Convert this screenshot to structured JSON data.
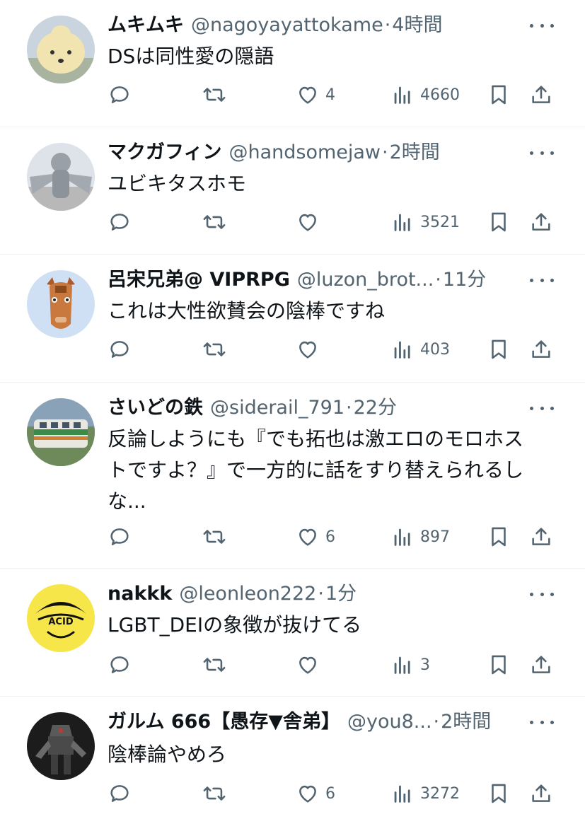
{
  "tweets": [
    {
      "name": "ムキムキ",
      "handle": "@nagoyayattokame",
      "sep": "·",
      "time": "4時間",
      "text": "DSは同性愛の隠語",
      "likes": "4",
      "views": "4660",
      "avatar": "avatar-1"
    },
    {
      "name": "マクガフィン",
      "handle": "@handsomejaw",
      "sep": "·",
      "time": "2時間",
      "text": "ユビキタスホモ",
      "likes": "",
      "views": "3521",
      "avatar": "avatar-2"
    },
    {
      "name": "呂宋兄弟@ VIPRPG",
      "handle": "@luzon_brot...",
      "sep": "·",
      "time": "11分",
      "text": "これは大性欲賛会の陰棒ですね",
      "likes": "",
      "views": "403",
      "avatar": "avatar-3"
    },
    {
      "name": "さいどの鉄",
      "handle": "@siderail_791",
      "sep": "·",
      "time": "22分",
      "text": "反論しようにも『でも拓也は激エロのモロホス\nトですよ？』で一方的に話をすり替えられるし\nな...",
      "likes": "6",
      "views": "897",
      "avatar": "avatar-4"
    },
    {
      "name": "nakkk",
      "handle": "@leonleon222",
      "sep": "·",
      "time": "1分",
      "text": "LGBT_DEIの象徴が抜けてる",
      "likes": "",
      "views": "3",
      "avatar": "avatar-5"
    },
    {
      "name": "ガルム 666【愚存▼舎弟】",
      "handle": "@you8...",
      "sep": "·",
      "time": "2時間",
      "text": "陰棒論やめろ",
      "likes": "6",
      "views": "3272",
      "avatar": "avatar-6"
    }
  ],
  "icons": {
    "reply": "reply-icon",
    "retweet": "retweet-icon",
    "like": "heart-icon",
    "views": "views-icon",
    "bookmark": "bookmark-icon",
    "share": "share-icon",
    "more": "more-icon"
  },
  "colors": {
    "text": "#0f1419",
    "secondary": "#536471",
    "divider": "#eff3f4"
  },
  "avatar_badge": {
    "text": "ACID"
  }
}
